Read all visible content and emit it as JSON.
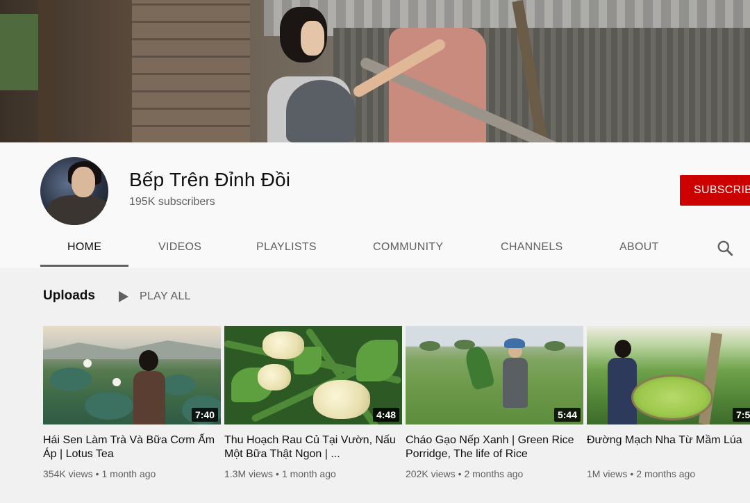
{
  "channel": {
    "name": "Bếp Trên Đỉnh Đồi",
    "subscribers": "195K subscribers",
    "subscribe_label": "SUBSCRIBE"
  },
  "tabs": [
    {
      "label": "HOME",
      "active": true
    },
    {
      "label": "VIDEOS",
      "active": false
    },
    {
      "label": "PLAYLISTS",
      "active": false
    },
    {
      "label": "COMMUNITY",
      "active": false
    },
    {
      "label": "CHANNELS",
      "active": false
    },
    {
      "label": "ABOUT",
      "active": false
    }
  ],
  "icons": {
    "search": "search-icon",
    "play": "play-icon"
  },
  "uploads": {
    "title": "Uploads",
    "play_all_label": "PLAY ALL"
  },
  "videos": [
    {
      "title": "Hái Sen Làm Trà Và Bữa Cơm Ấm Áp | Lotus Tea",
      "duration": "7:40",
      "views": "354K views",
      "age": "1 month ago"
    },
    {
      "title": "Thu Hoạch Rau Củ Tại Vườn, Nấu Một Bữa Thật Ngon | ...",
      "duration": "4:48",
      "views": "1.3M views",
      "age": "1 month ago"
    },
    {
      "title": "Cháo Gạo Nếp Xanh | Green Rice Porridge, The life of Rice",
      "duration": "5:44",
      "views": "202K views",
      "age": "2 months ago"
    },
    {
      "title": "Đường Mạch Nha Từ Mầm Lúa",
      "duration": "7:5",
      "views": "1M views",
      "age": "2 months ago"
    }
  ],
  "colors": {
    "subscribe": "#cc0000",
    "active_tab": "#0f0f0f",
    "secondary_text": "#606060"
  }
}
